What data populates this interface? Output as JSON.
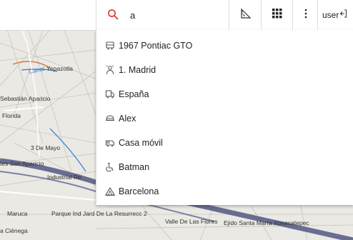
{
  "search": {
    "value": "a",
    "placeholder": ""
  },
  "toolbar": {
    "user_label": "user"
  },
  "results": [
    {
      "label": "1967 Pontiac GTO",
      "icon": "bus-icon"
    },
    {
      "label": "1. Madrid",
      "icon": "person-icon"
    },
    {
      "label": "España",
      "icon": "truck-icon"
    },
    {
      "label": "Alex",
      "icon": "helmet-icon"
    },
    {
      "label": "Casa móvil",
      "icon": "camper-icon"
    },
    {
      "label": "Batman",
      "icon": "wheelchair-icon"
    },
    {
      "label": "Barcelona",
      "icon": "tent-icon"
    }
  ],
  "map": {
    "labels": [
      "Canal",
      "Yepazotla",
      "Sebastián Aparicio",
      "Florida",
      "3 De Mayo",
      "tes San Aparicio",
      "Industrial Re",
      "Maruca",
      "Parque Ind Jard De La Resurrecc 2",
      "Valle De Las Flores",
      "Ejido Santa María Xonacatepec",
      "a Ciénega"
    ]
  },
  "colors": {
    "accent": "#d9382b",
    "route": "#5a5f87"
  }
}
